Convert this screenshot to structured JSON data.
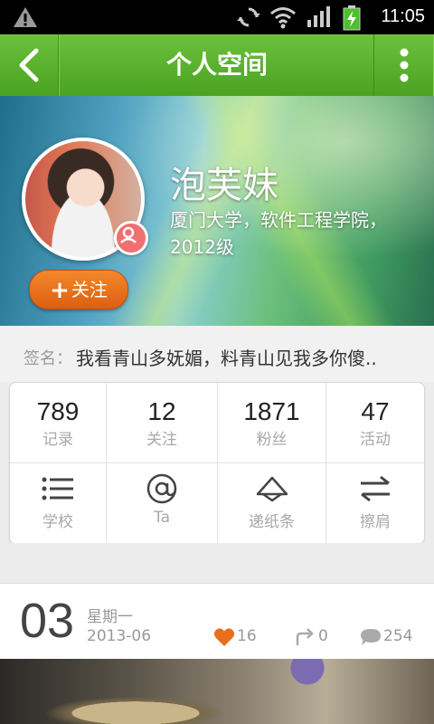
{
  "statusbar": {
    "time": "11:05"
  },
  "header": {
    "title": "个人空间"
  },
  "profile": {
    "name": "泡芙妹",
    "school": "厦门大学，软件工程学院，2012级",
    "follow_label": "关注"
  },
  "signature": {
    "label": "签名：",
    "text": "我看青山多妩媚，料青山见我多你傻.."
  },
  "stats": [
    {
      "num": "789",
      "label": "记录"
    },
    {
      "num": "12",
      "label": "关注"
    },
    {
      "num": "1871",
      "label": "粉丝"
    },
    {
      "num": "47",
      "label": "活动"
    }
  ],
  "actions": [
    {
      "label": "学校",
      "icon": "list-icon"
    },
    {
      "label": "Ta",
      "icon": "at-icon"
    },
    {
      "label": "递纸条",
      "icon": "note-icon"
    },
    {
      "label": "擦肩",
      "icon": "swap-icon"
    }
  ],
  "post": {
    "day": "03",
    "weekday": "星期一",
    "year_month": "2013-06",
    "likes": "16",
    "shares": "0",
    "comments": "254"
  },
  "colors": {
    "header_green": "#5cb52f",
    "follow_orange": "#e8701c",
    "like_orange": "#e8701c"
  }
}
